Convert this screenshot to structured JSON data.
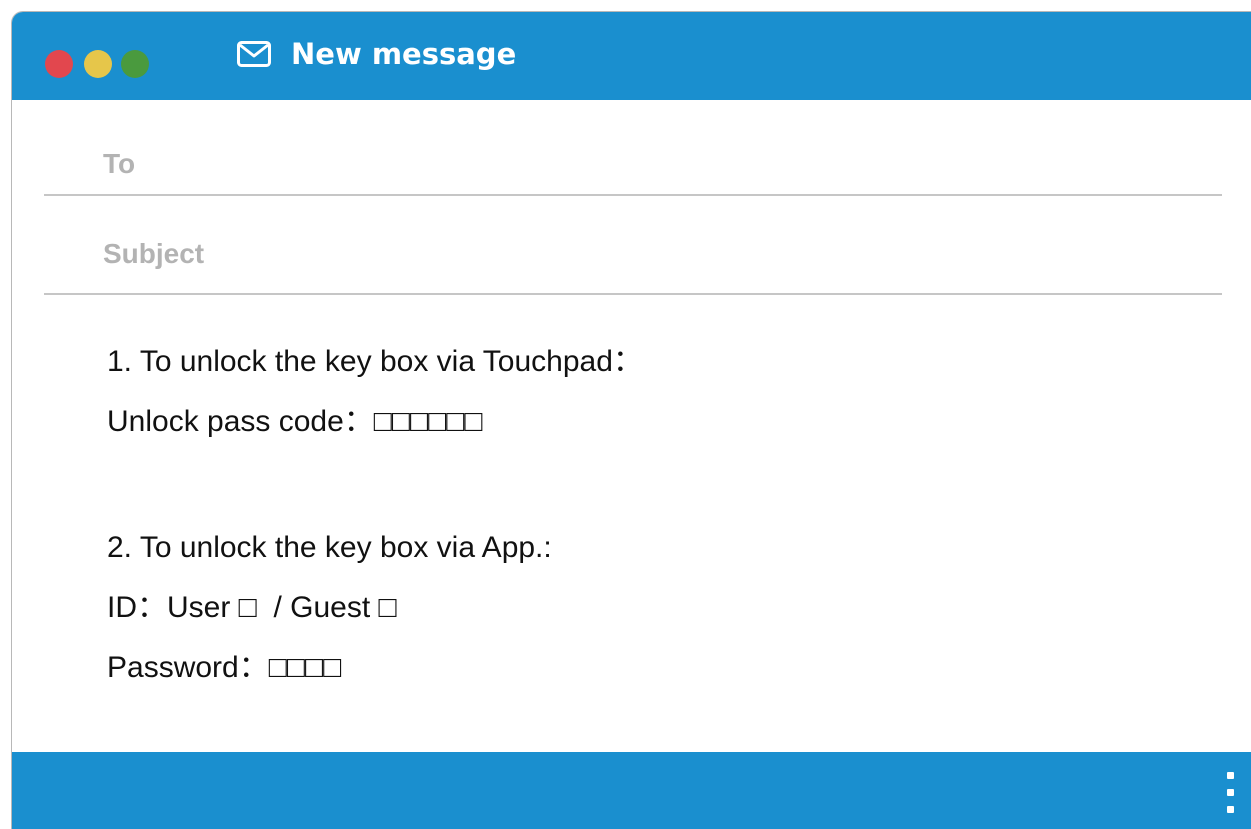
{
  "window": {
    "title": "New message",
    "icons": {
      "mail": "envelope-icon",
      "more": "more-vertical-icon"
    },
    "colors": {
      "titlebar": "#1a8fcf",
      "close": "#e2474e",
      "minimize": "#e6c64a",
      "maximize": "#4a9a3e"
    }
  },
  "fields": {
    "to_placeholder": "To",
    "subject_placeholder": "Subject"
  },
  "message": {
    "lines": [
      "1. To unlock the key box via Touchpad：",
      "Unlock pass code：□□□□□□",
      "2. To unlock the key box via App.:",
      "ID：User □  / Guest □",
      "Password：□□□□"
    ]
  }
}
